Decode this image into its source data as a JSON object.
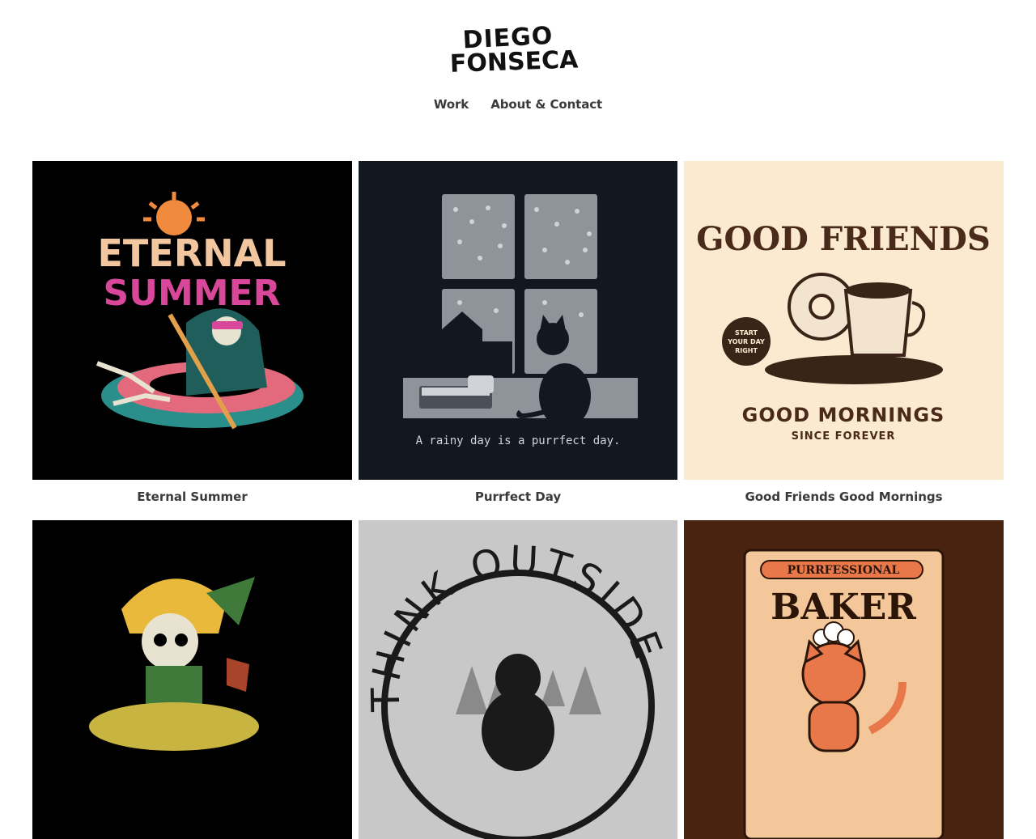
{
  "logo": {
    "line1": "DIEGO",
    "line2": "FONSECA"
  },
  "nav": {
    "items": [
      {
        "label": "Work"
      },
      {
        "label": "About & Contact"
      }
    ]
  },
  "projects": [
    {
      "title": "Eternal Summer",
      "art": {
        "line1": "ETERNAL",
        "line2": "SUMMER"
      },
      "bg": "#000000"
    },
    {
      "title": "Purrfect Day",
      "art": {
        "tagline": "A rainy day is a purrfect day."
      },
      "bg": "#121820"
    },
    {
      "title": "Good Friends Good Mornings",
      "art": {
        "top": "GOOD FRIENDS",
        "badge1": "START",
        "badge2": "YOUR DAY",
        "badge3": "RIGHT",
        "bottom": "GOOD MORNINGS",
        "sub": "SINCE FOREVER"
      },
      "bg": "#fbe9d0"
    },
    {
      "title": "",
      "art": {},
      "bg": "#000000"
    },
    {
      "title": "",
      "art": {
        "arc": "THINK OUTSIDE"
      },
      "bg": "#c8c8c8"
    },
    {
      "title": "",
      "art": {
        "banner": "PURRFESSIONAL",
        "word": "BAKER"
      },
      "bg": "#4a2210"
    }
  ],
  "colors": {
    "nav_text": "#3a3a3a",
    "accent_orange": "#f08a3c",
    "accent_pink": "#d9479a"
  }
}
